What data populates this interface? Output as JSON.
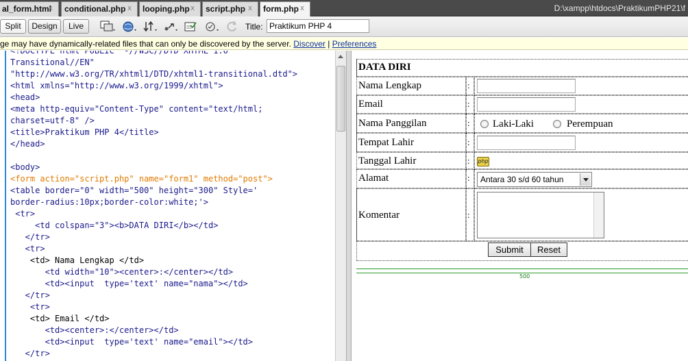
{
  "tabs": [
    {
      "label": "al_form.html",
      "close": "x"
    },
    {
      "label": "conditional.php",
      "close": "x"
    },
    {
      "label": "looping.php",
      "close": "x"
    },
    {
      "label": "script.php",
      "close": "x"
    },
    {
      "label": "form.php",
      "close": "x",
      "active": true
    }
  ],
  "path": "D:\\xampp\\htdocs\\PraktikumPHP21\\f",
  "toolbar": {
    "split_label": "Split",
    "design_label": "Design",
    "live_label": "Live",
    "title_label": "Title:",
    "title_value": "Praktikum PHP 4",
    "icons": [
      "multiscreen-icon",
      "browser-preview-icon",
      "file-management-icon",
      "visual-aids-icon",
      "validate-markup-icon",
      "check-browser-icon",
      "refresh-icon"
    ]
  },
  "infobar": {
    "message": "ge may have dynamically-related files that can only be discovered by the server.",
    "discover_label": "Discover",
    "separator": "|",
    "preferences_label": "Preferences"
  },
  "code_lines": [
    "<!DOCTYPE html PUBLIC \"-//W3C//DTD XHTML 1.0",
    "Transitional//EN\"",
    "\"http://www.w3.org/TR/xhtml1/DTD/xhtml1-transitional.dtd\">",
    "<html xmlns=\"http://www.w3.org/1999/xhtml\">",
    "<head>",
    "<meta http-equiv=\"Content-Type\" content=\"text/html;",
    "charset=utf-8\" />",
    "<title>Praktikum PHP 4</title>",
    "</head>",
    "",
    "<body>",
    "<form action=\"script.php\" name=\"form1\" method=\"post\">",
    "<table border=\"0\" width=\"500\" height=\"300\" Style='",
    "border-radius:10px;border-color:white;'>",
    " <tr>",
    "     <td colspan=\"3\"><b>DATA DIRI</b></td>",
    "   </tr>",
    "   <tr>",
    "    <td> Nama Lengkap </td>",
    "       <td width=\"10\"><center>:</center></td>",
    "       <td><input  type='text' name=\"nama\"></td>",
    "   </tr>",
    "    <tr>",
    "    <td> Email </td>",
    "       <td><center>:</center></td>",
    "       <td><input  type='text' name=\"email\"></td>",
    "   </tr>"
  ],
  "form": {
    "heading": "DATA DIRI",
    "rows": [
      {
        "label": "Nama Lengkap",
        "sep": ":"
      },
      {
        "label": "Email",
        "sep": ":"
      },
      {
        "label": "Nama Panggilan",
        "sep": ":"
      },
      {
        "label": "Tempat Lahir",
        "sep": ":"
      },
      {
        "label": "Tanggal Lahir",
        "sep": ":"
      },
      {
        "label": "Alamat",
        "sep": ":"
      },
      {
        "label": "Komentar",
        "sep": ":"
      }
    ],
    "radio_male": "Laki-Laki",
    "radio_female": "Perempuan",
    "php_icon": "php",
    "select_value": "Antara 30 s/d 60 tahun",
    "submit_label": "Submit",
    "reset_label": "Reset",
    "table_width_label": "500"
  }
}
